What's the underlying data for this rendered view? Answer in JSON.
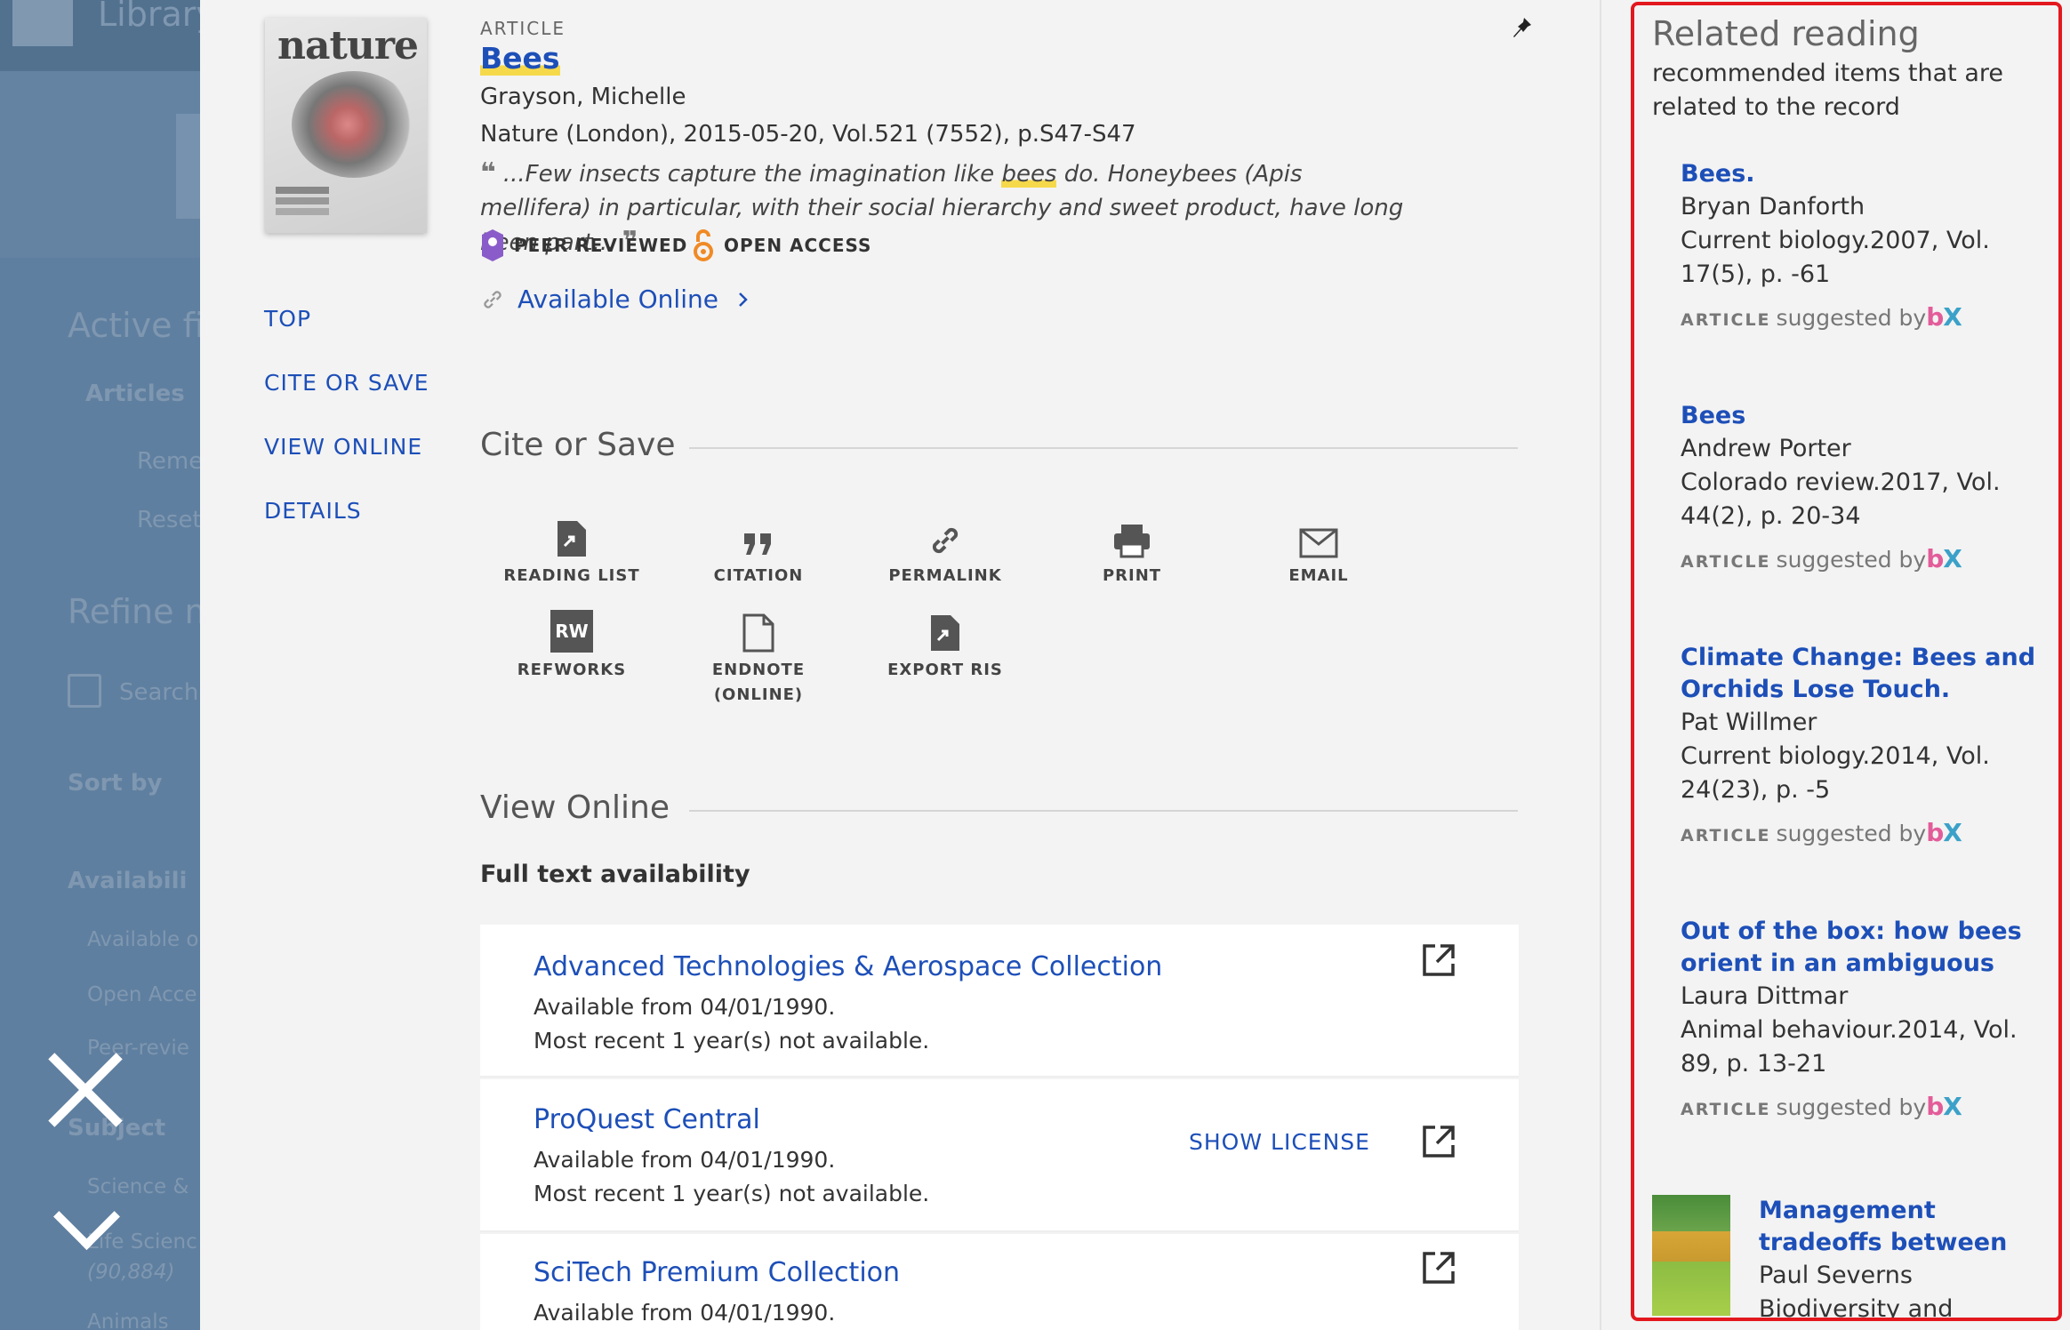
{
  "background": {
    "library_label": "Library",
    "active_filters_label": "Active fil",
    "filter_chip": "Articles",
    "remember_label": "Reme",
    "reset_label": "Reset",
    "refine_label": "Refine m",
    "search_label": "Search",
    "sort_label": "Sort by",
    "availability_label": "Availabili",
    "avail_item_1": "Available o",
    "avail_item_2": "Open Acce",
    "avail_item_3": "Peer-revie",
    "subject_label": "Subject",
    "subject_item_1": "Science &",
    "subject_item_2": "Life Scienc",
    "subject_count": "(90,884)",
    "subject_item_3": "Animals"
  },
  "record": {
    "type_label": "ARTICLE",
    "title": "Bees",
    "author": "Grayson, Michelle",
    "source": "Nature (London), 2015-05-20, Vol.521 (7552), p.S47-S47",
    "abstract_before": "...Few insects capture the imagination like ",
    "abstract_highlight": "bees",
    "abstract_after": " do. Honeybees (Apis mellifera) in particular, with their social hierarchy and sweet product, have long been part...",
    "peer_reviewed": "PEER REVIEWED",
    "open_access": "OPEN ACCESS",
    "available_online": "Available Online",
    "cover_text": "nature"
  },
  "nav": {
    "top": "TOP",
    "cite_or_save": "CITE OR SAVE",
    "view_online": "VIEW ONLINE",
    "details": "DETAILS"
  },
  "cite": {
    "heading": "Cite or Save",
    "actions": [
      "READING LIST",
      "CITATION",
      "PERMALINK",
      "PRINT",
      "EMAIL",
      "REFWORKS",
      "ENDNOTE (ONLINE)",
      "EXPORT RIS"
    ],
    "rw_glyph": "RW"
  },
  "view_online": {
    "heading": "View Online",
    "fulltext_heading": "Full text availability",
    "providers": [
      {
        "name": "Advanced Technologies & Aerospace Collection",
        "line1": "Available from 04/01/1990.",
        "line2": "Most recent 1 year(s) not available."
      },
      {
        "name": "ProQuest Central",
        "line1": "Available from 04/01/1990.",
        "line2": "Most recent 1 year(s) not available.",
        "license": "SHOW LICENSE"
      },
      {
        "name": "SciTech Premium Collection",
        "line1": "Available from 04/01/1990."
      }
    ]
  },
  "related": {
    "heading": "Related reading",
    "subheading": "recommended items that are related to the record",
    "type_label": "ARTICLE",
    "suggested": "suggested by",
    "bx_b": "b",
    "bx_x": "X",
    "items": [
      {
        "title": "Bees.",
        "author": "Bryan Danforth",
        "source": "Current biology.2007, Vol. 17(5), p. -61"
      },
      {
        "title": "Bees",
        "author": "Andrew Porter",
        "source": "Colorado review.2017, Vol. 44(2), p. 20-34"
      },
      {
        "title": "Climate Change: Bees and Orchids Lose Touch.",
        "author": "Pat Willmer",
        "source": "Current biology.2014, Vol. 24(23), p. -5"
      },
      {
        "title": "Out of the box: how bees orient in an ambiguous",
        "author": "Laura Dittmar",
        "source": "Animal behaviour.2014, Vol. 89, p. 13-21"
      },
      {
        "title": "Management tradeoffs between",
        "author": "Paul Severns",
        "source": "Biodiversity and"
      }
    ]
  },
  "colors": {
    "link": "#1d4fb8",
    "highlight": "#f6d94a",
    "related_border": "#e3181f",
    "peer_reviewed_icon": "#8a5cc9",
    "open_access_icon": "#f08a24"
  },
  "icons": {
    "close": "close-icon",
    "collapse": "chevron-down-icon",
    "pin": "pin-icon",
    "link": "link-icon",
    "chevron": "chevron-right-icon",
    "external": "external-link-icon"
  }
}
